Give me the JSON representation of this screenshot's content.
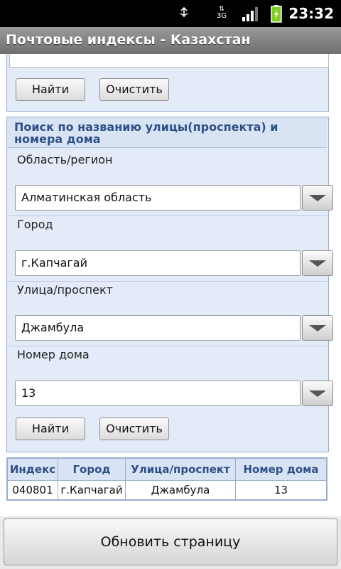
{
  "status_bar": {
    "network": "3G",
    "time": "23:32"
  },
  "title_bar": {
    "title": "Почтовые индексы - Казахстан"
  },
  "top_panel": {
    "find_label": "Найти",
    "clear_label": "Очистить"
  },
  "street_search": {
    "header": "Поиск по названию улицы(проспекта) и номера дома",
    "region": {
      "label": "Область/регион",
      "value": "Алматинская область"
    },
    "city": {
      "label": "Город",
      "value": "г.Капчагай"
    },
    "street": {
      "label": "Улица/проспект",
      "value": "Джамбула"
    },
    "house": {
      "label": "Номер дома",
      "value": "13"
    },
    "find_label": "Найти",
    "clear_label": "Очистить"
  },
  "results": {
    "headers": [
      "Индекс",
      "Город",
      "Улица/проспект",
      "Номер дома"
    ],
    "rows": [
      [
        "040801",
        "г.Капчагай",
        "Джамбула",
        "13"
      ]
    ]
  },
  "footer": {
    "refresh_label": "Обновить страницу"
  },
  "colors": {
    "header_text": "#2e4f88",
    "panel_bg": "#e3ebf8",
    "panel_border": "#9aaed0"
  }
}
